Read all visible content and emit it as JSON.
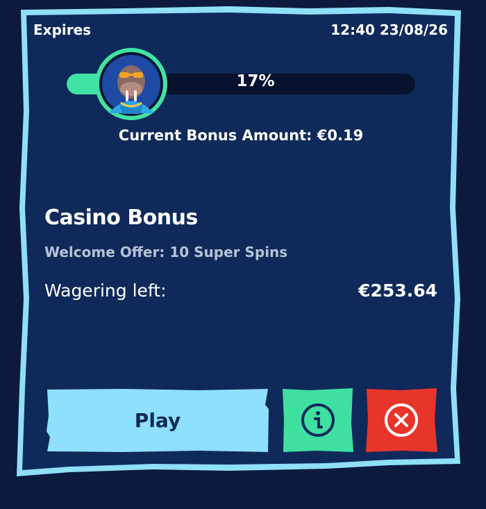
{
  "bonus_card": {
    "expires_label": "Expires",
    "expires_datetime": "12:40 23/08/26",
    "progress": {
      "percent_label": "17%",
      "fraction": 0.17
    },
    "current_bonus": "Current Bonus Amount: €0.19",
    "title": "Casino Bonus",
    "subtitle": "Welcome Offer: 10 Super Spins",
    "wagering_label": "Wagering left:",
    "wagering_value": "€253.64",
    "play_label": "Play",
    "info_icon": "info-icon",
    "cancel_icon": "close-icon"
  },
  "colors": {
    "background": "#0c1a3e",
    "card": "#0f2a5a",
    "border": "#8fdff7",
    "progress_fill": "#41e3a3",
    "progress_track": "#08122e",
    "play_button": "#8fe0fa",
    "info_button": "#3fe0a0",
    "cancel_button": "#e8352c"
  }
}
